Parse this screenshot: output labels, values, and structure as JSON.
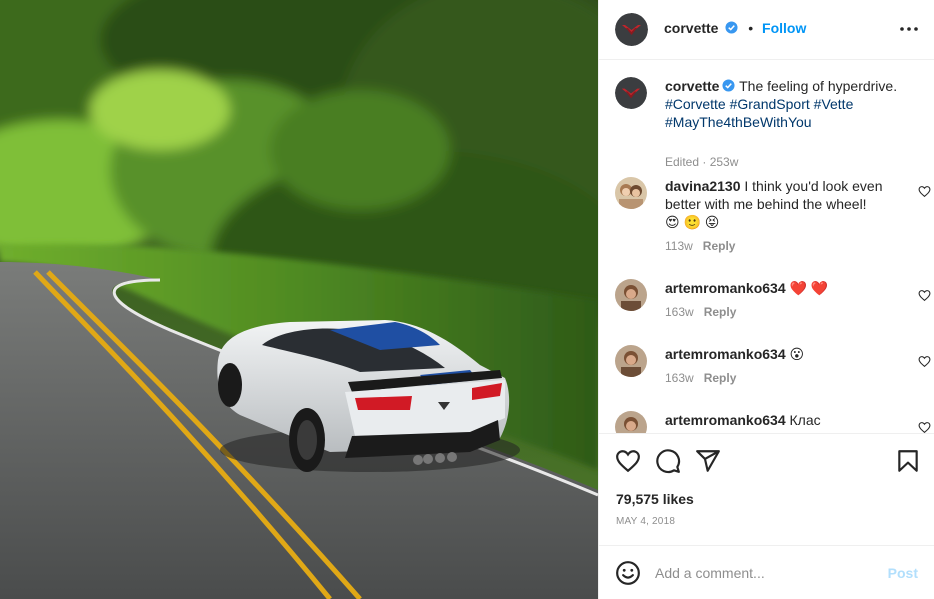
{
  "post": {
    "image_alt": "White Corvette Grand Sport with blue stripes driving on a winding road through a forest",
    "account": {
      "username": "corvette",
      "verified": true,
      "separator": "•",
      "follow_label": "Follow",
      "more_icon": "more-horizontal-icon"
    },
    "caption": {
      "username": "corvette",
      "text": "The feeling of hyperdrive.",
      "hashtags_line1": [
        "#Corvette",
        "#GrandSport",
        "#Vette"
      ],
      "hashtags_line2": [
        "#MayThe4thBeWithYou"
      ],
      "meta": "Edited · 253w"
    },
    "comments": [
      {
        "username": "davina2130",
        "text_line1": "I think you'd look even",
        "text_line2": "better with me behind the wheel!",
        "emojis": "😍 🙂 😝",
        "age": "113w",
        "reply_label": "Reply"
      },
      {
        "username": "artemromanko634",
        "text": "❤️ ❤️",
        "age": "163w",
        "reply_label": "Reply"
      },
      {
        "username": "artemromanko634",
        "text": "😮",
        "age": "163w",
        "reply_label": "Reply"
      },
      {
        "username": "artemromanko634",
        "text": "Клас"
      }
    ],
    "likes": "79,575 likes",
    "date": "MAY 4, 2018",
    "add_comment": {
      "placeholder": "Add a comment...",
      "post_label": "Post"
    },
    "colors": {
      "link_blue": "#0095f6",
      "hashtag": "#00376b",
      "muted": "#8e8e8e",
      "post_disabled": "#b2dffc",
      "verified": "#3897f0"
    }
  }
}
